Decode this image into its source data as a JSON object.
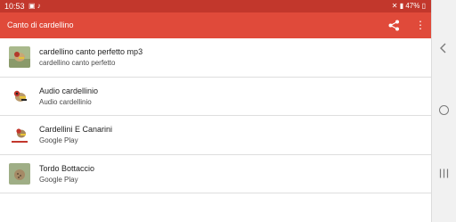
{
  "status_bar": {
    "time": "10:53",
    "battery": "47%",
    "left_icons": [
      "image-icon",
      "music-note-icon"
    ],
    "right_icons": [
      "mute-icon",
      "signal-icon",
      "battery-icon"
    ]
  },
  "app_bar": {
    "title": "Canto di cardellino",
    "icons": [
      "share-icon",
      "more-vert-icon"
    ]
  },
  "items": [
    {
      "title": "cardellino canto perfetto mp3",
      "subtitle": "cardellino canto perfetto",
      "thumb": "goldfinch-on-branch"
    },
    {
      "title": "Audio cardellinio",
      "subtitle": "Audio cardellinio",
      "thumb": "goldfinch-white-bg"
    },
    {
      "title": "Cardellini E Canarini",
      "subtitle": "Google Play",
      "thumb": "goldfinch-logo"
    },
    {
      "title": "Tordo Bottaccio",
      "subtitle": "Google Play",
      "thumb": "thrush"
    }
  ],
  "colors": {
    "status_bar": "#c2372c",
    "app_bar": "#e04a3a",
    "nav_bar": "#f1f1f1"
  }
}
